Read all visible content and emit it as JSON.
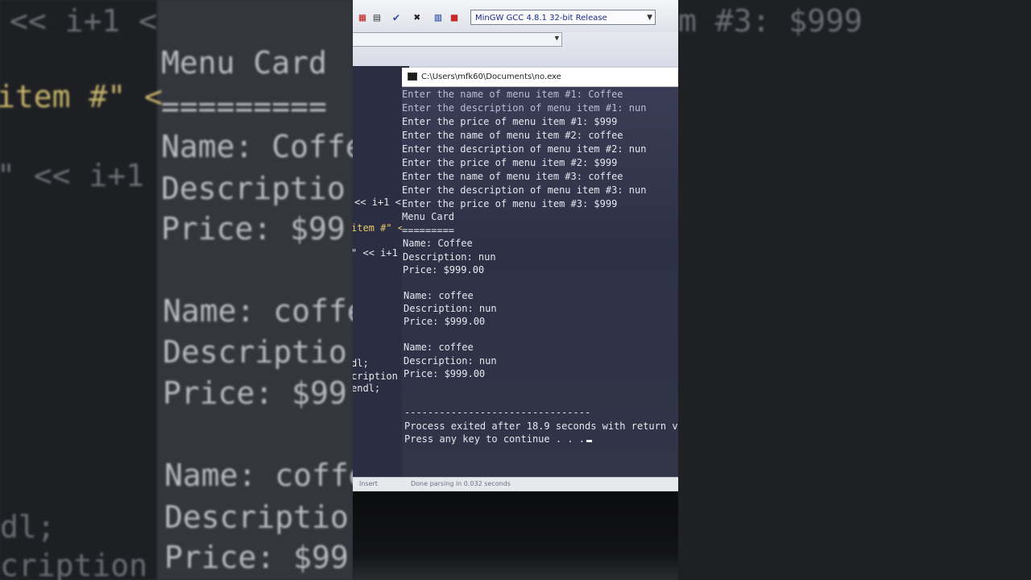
{
  "toolbar": {
    "compiler_select": "MinGW GCC 4.8.1 32-bit Release",
    "icons": [
      "grid-icon",
      "grid-alt-icon",
      "check-icon",
      "close-icon",
      "chart-icon",
      "stop-icon"
    ]
  },
  "editor": {
    "fragments": [
      "<< i+1 <",
      "item #\" <",
      "\" << i+1",
      "dl;",
      "cription",
      " endl;"
    ]
  },
  "console": {
    "title": "C:\\Users\\mfk60\\Documents\\no.exe",
    "lines": [
      "Enter the name of menu item #1: Coffee",
      "Enter the description of menu item #1: nun",
      "Enter the price of menu item #1: $999",
      "Enter the name of menu item #2: coffee",
      "Enter the description of menu item #2: nun",
      "Enter the price of menu item #2: $999",
      "Enter the name of menu item #3: coffee",
      "Enter the description of menu item #3: nun",
      "Enter the price of menu item #3: $999",
      "Menu Card",
      "=========",
      "Name: Coffee",
      "Description: nun",
      "Price: $999.00",
      "Name: coffee",
      "Description: nun",
      "Price: $999.00",
      "Name: coffee",
      "Description: nun",
      "Price: $999.00",
      "--------------------------------",
      "Process exited after 18.9 seconds with return v",
      "Press any key to continue . . ."
    ]
  },
  "statusbar": {
    "mode": "Insert",
    "message": "Done parsing in 0.032 seconds"
  },
  "background": {
    "left": [
      "<< i+1 <",
      "Menu Card",
      "item #\" <",
      "=========",
      "Name: Coffe",
      "\" << i+1",
      "Descriptio",
      "Price: $99",
      "Name: coffe",
      "Descriptio",
      "Price: $99",
      "Name: coffe",
      "dl;",
      "Descriptio",
      "cription",
      "Price: $99"
    ],
    "right": [
      "m #3: $999"
    ]
  }
}
